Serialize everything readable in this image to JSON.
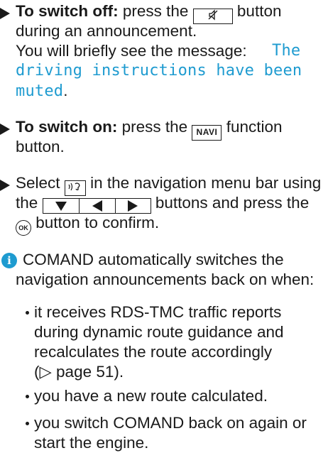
{
  "steps": {
    "switch_off": {
      "label": "To switch off:",
      "l1_pre": "press the",
      "mute_key_icon": "mute-speaker-icon",
      "l1_post": "button",
      "l2": "during an announcement.",
      "l3": "You will briefly see the message:",
      "message_l1": "The",
      "message_l2": "driving instructions have been",
      "message_l3": "muted",
      "message_period": "."
    },
    "switch_on": {
      "label": "To switch on:",
      "l1_pre": "press the",
      "navi_key": "NAVI",
      "l1_post": "function",
      "l2": "button."
    },
    "select": {
      "l1_pre": "Select",
      "voice_icon": "voice-output-icon",
      "l1_post": "in the navigation menu bar using",
      "l2_pre": "the",
      "l2_post": "buttons and press the",
      "ok_label": "OK",
      "l3_post": "button to confirm."
    }
  },
  "info": {
    "icon": "info-icon",
    "icon_glyph": "i",
    "l1": "COMAND automatically switches the",
    "l2": "navigation announcements back on when:",
    "bullets": {
      "b1": {
        "l1": "it receives RDS-TMC traffic reports",
        "l2": "during dynamic route guidance and",
        "l3": "recalculates the route accordingly",
        "l4": "(▷ page 51)."
      },
      "b2": {
        "l1": "you have a new route calculated."
      },
      "b3": {
        "l1": "you switch COMAND back on again or",
        "l2": "start the engine."
      }
    }
  },
  "colors": {
    "display_text": "#1e9bd0",
    "info_icon": "#1e9bd0",
    "text": "#1a1a1a"
  }
}
